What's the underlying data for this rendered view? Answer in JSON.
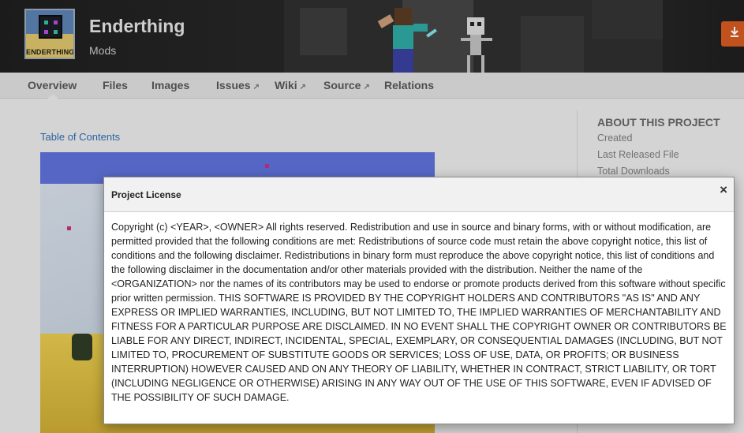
{
  "header": {
    "title": "Enderthing",
    "subtitle": "Mods",
    "logo_text": "ENDERTHING",
    "action_icon": "download-icon"
  },
  "tabs": [
    {
      "label": "Overview",
      "external": false,
      "active": true
    },
    {
      "label": "Files",
      "external": false
    },
    {
      "label": "Images",
      "external": false
    },
    {
      "label": "Issues",
      "external": true
    },
    {
      "label": "Wiki",
      "external": true
    },
    {
      "label": "Source",
      "external": true
    },
    {
      "label": "Relations",
      "external": false
    }
  ],
  "main": {
    "toc_link": "Table of Contents"
  },
  "sidebar": {
    "title": "ABOUT THIS PROJECT",
    "rows": [
      "Created",
      "Last Released File",
      "Total Downloads"
    ]
  },
  "modal": {
    "title": "Project License",
    "close_glyph": "×",
    "body": "Copyright (c) <YEAR>, <OWNER> All rights reserved. Redistribution and use in source and binary forms, with or without modification, are permitted provided that the following conditions are met: Redistributions of source code must retain the above copyright notice, this list of conditions and the following disclaimer. Redistributions in binary form must reproduce the above copyright notice, this list of conditions and the following disclaimer in the documentation and/or other materials provided with the distribution. Neither the name of the <ORGANIZATION> nor the names of its contributors may be used to endorse or promote products derived from this software without specific prior written permission. THIS SOFTWARE IS PROVIDED BY THE COPYRIGHT HOLDERS AND CONTRIBUTORS \"AS IS\" AND ANY EXPRESS OR IMPLIED WARRANTIES, INCLUDING, BUT NOT LIMITED TO, THE IMPLIED WARRANTIES OF MERCHANTABILITY AND FITNESS FOR A PARTICULAR PURPOSE ARE DISCLAIMED. IN NO EVENT SHALL THE COPYRIGHT OWNER OR CONTRIBUTORS BE LIABLE FOR ANY DIRECT, INDIRECT, INCIDENTAL, SPECIAL, EXEMPLARY, OR CONSEQUENTIAL DAMAGES (INCLUDING, BUT NOT LIMITED TO, PROCUREMENT OF SUBSTITUTE GOODS OR SERVICES; LOSS OF USE, DATA, OR PROFITS; OR BUSINESS INTERRUPTION) HOWEVER CAUSED AND ON ANY THEORY OF LIABILITY, WHETHER IN CONTRACT, STRICT LIABILITY, OR TORT (INCLUDING NEGLIGENCE OR OTHERWISE) ARISING IN ANY WAY OUT OF THE USE OF THIS SOFTWARE, EVEN IF ADVISED OF THE POSSIBILITY OF SUCH DAMAGE."
  },
  "colors": {
    "accent": "#d25a21",
    "link": "#2f6cae"
  }
}
